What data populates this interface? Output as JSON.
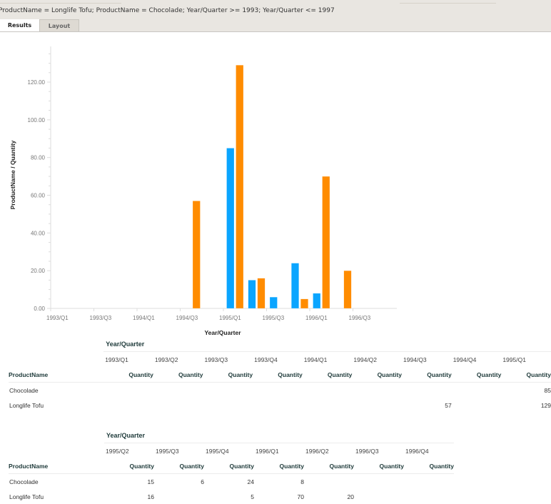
{
  "header": {
    "filter_text": "ProductName = Longlife Tofu; ProductName = Chocolade; Year/Quarter >= 1993; Year/Quarter <= 1997"
  },
  "tabs": [
    {
      "label": "Results",
      "active": true
    },
    {
      "label": "Layout",
      "active": false
    }
  ],
  "chart_data": {
    "type": "bar",
    "title": "",
    "xlabel": "Year/Quarter",
    "ylabel": "ProductName / Quantity",
    "ylim": [
      0,
      140
    ],
    "yticks": [
      0,
      20,
      40,
      60,
      80,
      100,
      120
    ],
    "ytick_labels": [
      "0.00",
      "20.00",
      "40.00",
      "60.00",
      "80.00",
      "100.00",
      "120.00"
    ],
    "categories": [
      "1993/Q1",
      "1993/Q2",
      "1993/Q3",
      "1993/Q4",
      "1994/Q1",
      "1994/Q2",
      "1994/Q3",
      "1994/Q4",
      "1995/Q1",
      "1995/Q2",
      "1995/Q3",
      "1995/Q4",
      "1996/Q1",
      "1996/Q2",
      "1996/Q3",
      "1996/Q4"
    ],
    "xtick_labels": [
      "1993/Q1",
      "1993/Q3",
      "1994/Q1",
      "1994/Q3",
      "1995/Q1",
      "1995/Q3",
      "1996/Q1",
      "1996/Q3"
    ],
    "series": [
      {
        "name": "Chocolade",
        "color": "#0aa5ff",
        "values": [
          null,
          null,
          null,
          null,
          null,
          null,
          null,
          null,
          85,
          15,
          6,
          24,
          8,
          null,
          null,
          null
        ]
      },
      {
        "name": "Longlife Tofu",
        "color": "#ff8c00",
        "values": [
          null,
          null,
          null,
          null,
          null,
          null,
          57,
          null,
          129,
          16,
          null,
          5,
          70,
          20,
          null,
          null
        ]
      }
    ],
    "grid": false,
    "legend": "none"
  },
  "tables": [
    {
      "dim_label": "Year/Quarter",
      "row_header": "ProductName",
      "columns": [
        "1993/Q1",
        "1993/Q2",
        "1993/Q3",
        "1993/Q4",
        "1994/Q1",
        "1994/Q2",
        "1994/Q3",
        "1994/Q4",
        "1995/Q1"
      ],
      "measure": "Quantity",
      "rows": [
        {
          "label": "Chocolade",
          "values": [
            "",
            "",
            "",
            "",
            "",
            "",
            "",
            "",
            "85"
          ]
        },
        {
          "label": "Longlife Tofu",
          "values": [
            "",
            "",
            "",
            "",
            "",
            "",
            "57",
            "",
            "129"
          ]
        }
      ]
    },
    {
      "dim_label": "Year/Quarter",
      "row_header": "ProductName",
      "columns": [
        "1995/Q2",
        "1995/Q3",
        "1995/Q4",
        "1996/Q1",
        "1996/Q2",
        "1996/Q3",
        "1996/Q4"
      ],
      "measure": "Quantity",
      "rows": [
        {
          "label": "Chocolade",
          "values": [
            "15",
            "6",
            "24",
            "8",
            "",
            "",
            ""
          ]
        },
        {
          "label": "Longlife Tofu",
          "values": [
            "16",
            "",
            "5",
            "70",
            "20",
            "",
            ""
          ]
        }
      ]
    }
  ]
}
